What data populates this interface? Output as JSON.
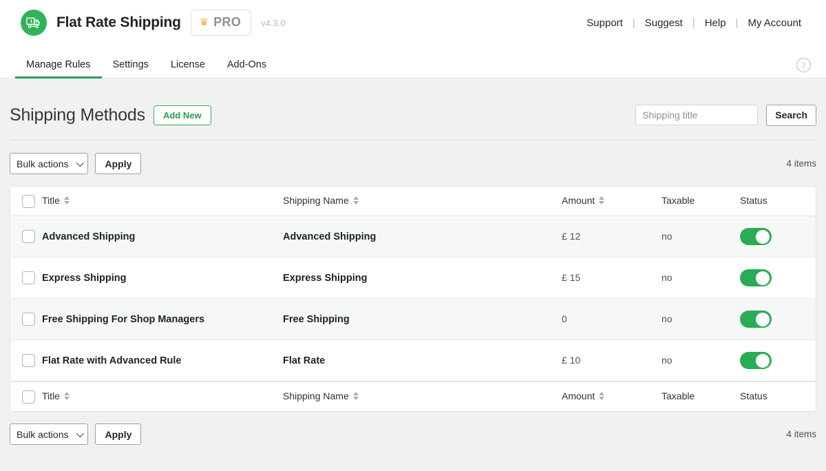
{
  "header": {
    "logo_icon": "delivery-truck-dollar-icon",
    "brand_title": "Flat Rate Shipping",
    "pro_badge": {
      "crown_icon": "crown-icon",
      "label": "PRO"
    },
    "version": "v4.3.0",
    "links": [
      "Support",
      "Suggest",
      "Help",
      "My Account"
    ],
    "separator": "|"
  },
  "tabs": [
    {
      "label": "Manage Rules",
      "active": true
    },
    {
      "label": "Settings",
      "active": false
    },
    {
      "label": "License",
      "active": false
    },
    {
      "label": "Add-Ons",
      "active": false
    }
  ],
  "help_icon": {
    "name": "help-circle-icon",
    "glyph": "?"
  },
  "page": {
    "title": "Shipping Methods",
    "add_new_label": "Add New",
    "search": {
      "placeholder": "Shipping title",
      "value": "",
      "button_label": "Search"
    }
  },
  "bulk": {
    "select_label": "Bulk actions",
    "apply_label": "Apply",
    "item_count_top": "4 items",
    "item_count_bottom": "4 items"
  },
  "table": {
    "columns": [
      {
        "key": "title",
        "label": "Title",
        "sortable": true
      },
      {
        "key": "name",
        "label": "Shipping Name",
        "sortable": true
      },
      {
        "key": "amount",
        "label": "Amount",
        "sortable": true
      },
      {
        "key": "tax",
        "label": "Taxable",
        "sortable": false
      },
      {
        "key": "status",
        "label": "Status",
        "sortable": false
      }
    ],
    "rows": [
      {
        "title": "Advanced Shipping",
        "name": "Advanced Shipping",
        "amount": "£ 12",
        "tax": "no",
        "status_on": true
      },
      {
        "title": "Express Shipping",
        "name": "Express Shipping",
        "amount": "£ 15",
        "tax": "no",
        "status_on": true
      },
      {
        "title": "Free Shipping For Shop Managers",
        "name": "Free Shipping",
        "amount": "0",
        "tax": "no",
        "status_on": true
      },
      {
        "title": "Flat Rate with Advanced Rule",
        "name": "Flat Rate",
        "amount": "£ 10",
        "tax": "no",
        "status_on": true
      }
    ]
  },
  "colors": {
    "brand_green": "#2fb457",
    "tab_active_underline": "#24a453",
    "toggle_on": "#2aab56",
    "add_new_border": "#2fb457",
    "pro_crown": "#f3a92b",
    "page_bg": "#f1f1f1",
    "row_alt_bg": "#f6f7f7"
  }
}
